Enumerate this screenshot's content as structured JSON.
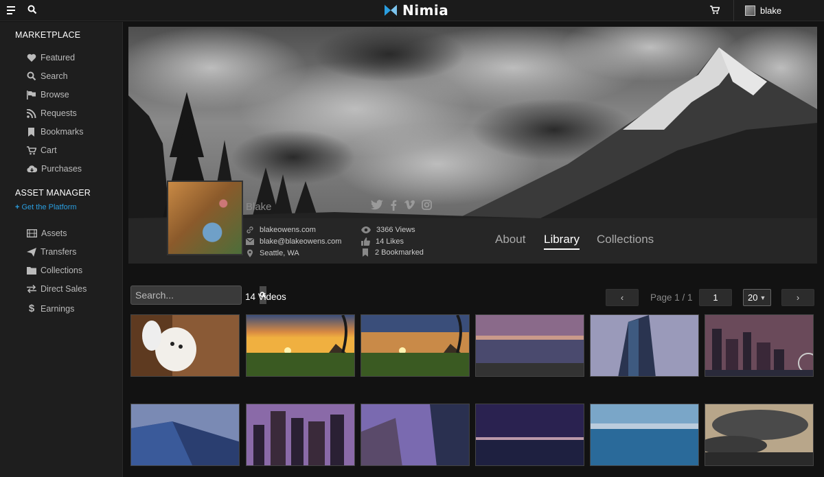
{
  "topbar": {
    "logo": "Nimia",
    "username": "blake"
  },
  "sidebar": {
    "marketplace_title": "MARKETPLACE",
    "marketplace_items": [
      {
        "label": "Featured",
        "icon": "heart-icon"
      },
      {
        "label": "Search",
        "icon": "search-icon"
      },
      {
        "label": "Browse",
        "icon": "flag-icon"
      },
      {
        "label": "Requests",
        "icon": "rss-icon"
      },
      {
        "label": "Bookmarks",
        "icon": "bookmark-icon"
      },
      {
        "label": "Cart",
        "icon": "cart-icon"
      },
      {
        "label": "Purchases",
        "icon": "cloud-download-icon"
      }
    ],
    "asset_title": "ASSET MANAGER",
    "platform_link": "Get the Platform",
    "asset_items": [
      {
        "label": "Assets",
        "icon": "film-icon"
      },
      {
        "label": "Transfers",
        "icon": "send-icon"
      },
      {
        "label": "Collections",
        "icon": "folder-icon"
      },
      {
        "label": "Direct Sales",
        "icon": "exchange-icon"
      },
      {
        "label": "Earnings",
        "icon": "dollar-icon"
      }
    ]
  },
  "profile": {
    "name": "Blake",
    "website": "blakeowens.com",
    "email": "blake@blakeowens.com",
    "location": "Seattle, WA",
    "views": "3366 Views",
    "likes": "14 Likes",
    "bookmarked": "2 Bookmarked",
    "social_icons": [
      "twitter-icon",
      "facebook-icon",
      "vimeo-icon",
      "instagram-icon"
    ]
  },
  "tabs": {
    "about": "About",
    "library": "Library",
    "collections": "Collections",
    "active": "Library"
  },
  "library": {
    "search_placeholder": "Search...",
    "video_count": "14 Videos",
    "page_info": "Page 1 / 1",
    "page_number": "1",
    "per_page": "20",
    "prev": "‹",
    "next": "›"
  },
  "colors": {
    "accent": "#2a9ee0",
    "background": "#121212",
    "sidebar": "#1e1e1e"
  }
}
